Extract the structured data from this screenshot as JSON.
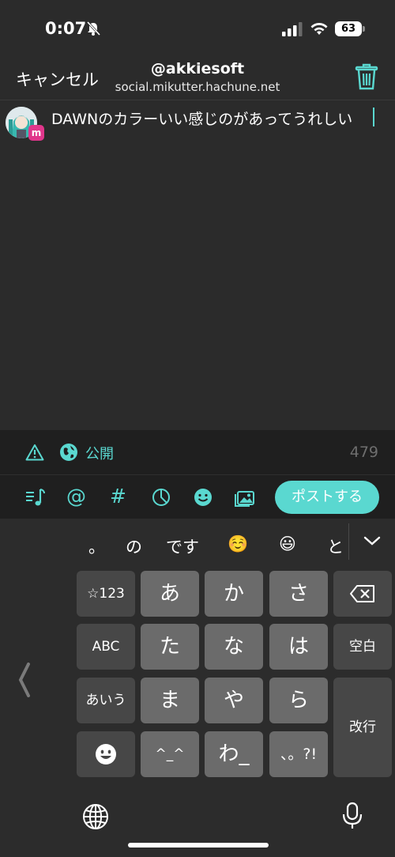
{
  "status_bar": {
    "time": "0:07",
    "battery": "63"
  },
  "header": {
    "cancel_label": "キャンセル",
    "account_name": "@akkiesoft",
    "account_server": "social.mikutter.hachune.net"
  },
  "compose": {
    "text": "DAWNのカラーいい感じのがあってうれしい"
  },
  "options": {
    "visibility": "公開",
    "char_count": "479"
  },
  "toolbar": {
    "at": "@",
    "hash": "#",
    "post_label": "ポストする"
  },
  "keyboard": {
    "candidates": [
      "。",
      "の",
      "です",
      "☺️",
      "😃",
      "と"
    ],
    "keys": {
      "sym": "☆123",
      "abc": "ABC",
      "aiu": "あいう",
      "a": "あ",
      "ka": "か",
      "sa": "さ",
      "ta": "た",
      "na": "な",
      "ha": "は",
      "ma": "ま",
      "ya": "や",
      "ra": "ら",
      "kao": "^_^",
      "wa": "わ_",
      "punct": "、。?!",
      "space": "空白",
      "enter": "改行"
    }
  },
  "colors": {
    "accent": "#5ad8d0",
    "badge": "#e0368b"
  }
}
